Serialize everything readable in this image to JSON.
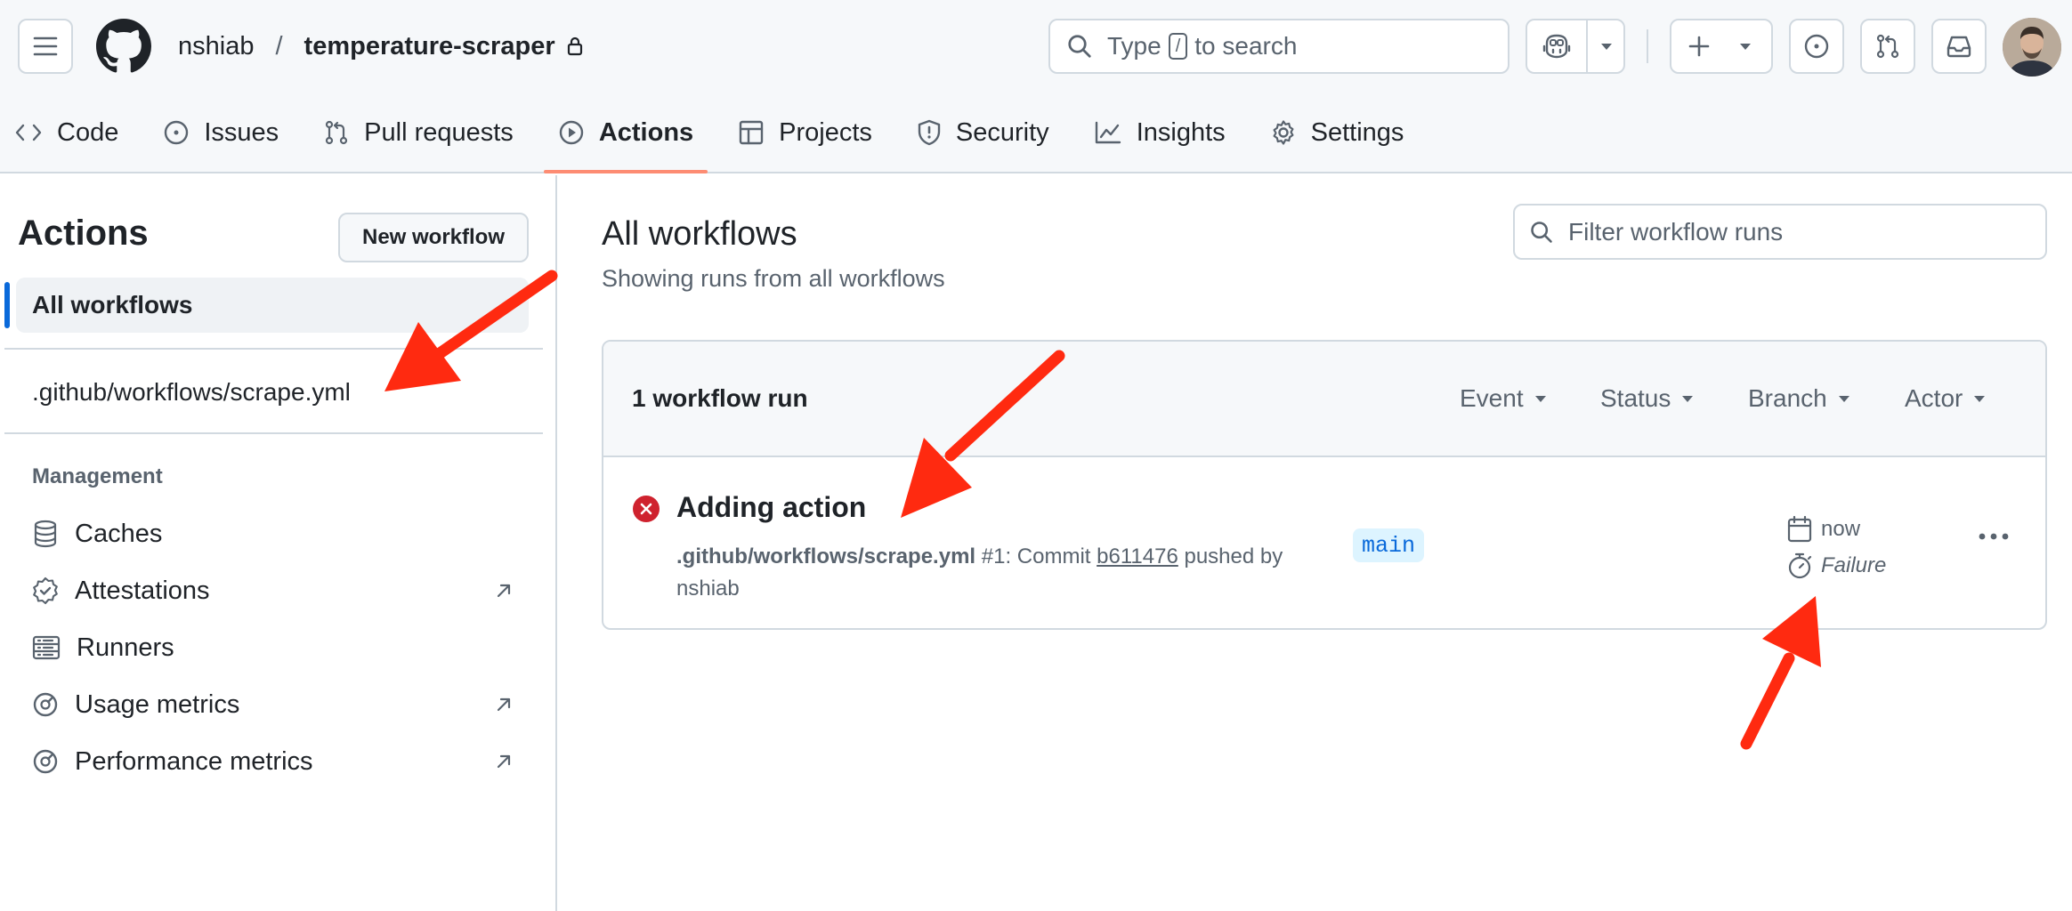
{
  "header": {
    "owner": "nshiab",
    "separator": "/",
    "repo": "temperature-scraper",
    "search": {
      "before": "Type",
      "key": "/",
      "after": "to search"
    }
  },
  "tabs": [
    {
      "label": "Code",
      "icon": "code-icon"
    },
    {
      "label": "Issues",
      "icon": "issue-icon"
    },
    {
      "label": "Pull requests",
      "icon": "pull-request-icon"
    },
    {
      "label": "Actions",
      "icon": "play-icon",
      "active": true
    },
    {
      "label": "Projects",
      "icon": "table-icon"
    },
    {
      "label": "Security",
      "icon": "shield-icon"
    },
    {
      "label": "Insights",
      "icon": "graph-icon"
    },
    {
      "label": "Settings",
      "icon": "gear-icon"
    }
  ],
  "sidebar": {
    "title": "Actions",
    "new_workflow": "New workflow",
    "all_workflows": "All workflows",
    "workflow_file": ".github/workflows/scrape.yml",
    "management_label": "Management",
    "management": [
      {
        "label": "Caches",
        "icon": "database-icon"
      },
      {
        "label": "Attestations",
        "icon": "verified-icon",
        "external": true
      },
      {
        "label": "Runners",
        "icon": "server-icon"
      },
      {
        "label": "Usage metrics",
        "icon": "meter-icon",
        "external": true
      },
      {
        "label": "Performance metrics",
        "icon": "meter-icon",
        "external": true
      }
    ]
  },
  "main": {
    "title": "All workflows",
    "subtitle": "Showing runs from all workflows",
    "filter_placeholder": "Filter workflow runs",
    "runs_count": "1 workflow run",
    "filters": [
      "Event",
      "Status",
      "Branch",
      "Actor"
    ],
    "run": {
      "title": "Adding action",
      "workflow": ".github/workflows/scrape.yml",
      "run_number": "#1",
      "commit_label": "Commit",
      "sha": "b611476",
      "pushed_by": "pushed by",
      "actor": "nshiab",
      "branch": "main",
      "when": "now",
      "status": "Failure"
    }
  },
  "colors": {
    "failure": "#cf222e",
    "accent": "#0969da",
    "tab_underline": "#fd8c73",
    "annotation_arrow": "#ff2a10"
  }
}
